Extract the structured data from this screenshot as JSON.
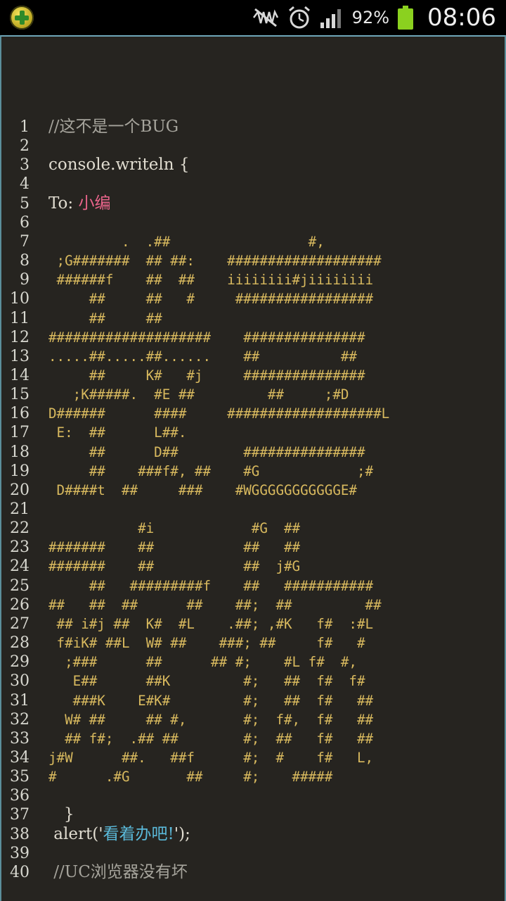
{
  "status_bar": {
    "battery_percent": "92%",
    "battery_level": 0.92,
    "time": "08:06",
    "icons": [
      "app-icon",
      "mute-icon",
      "alarm-icon",
      "signal-icon",
      "battery-icon"
    ],
    "colors": {
      "battery": "#8bd11f"
    }
  },
  "editor": {
    "background": "#262420",
    "lines": [
      {
        "n": "1",
        "text": "//这不是一个BUG"
      },
      {
        "n": "2",
        "text": ""
      },
      {
        "n": "3",
        "text": "console.writeln {"
      },
      {
        "n": "4",
        "text": ""
      },
      {
        "n": "5",
        "text": "To: ",
        "highlight": "小编"
      },
      {
        "n": "6",
        "text": ""
      },
      {
        "n": "7",
        "text": "         .  .##                 #,"
      },
      {
        "n": "8",
        "text": " ;G#######  ## ##:    ###################"
      },
      {
        "n": "9",
        "text": " ######f    ##  ##    iiiiiiii#jiiiiiiii"
      },
      {
        "n": "10",
        "text": "     ##     ##   #     #################"
      },
      {
        "n": "11",
        "text": "     ##     ##"
      },
      {
        "n": "12",
        "text": "####################    ###############"
      },
      {
        "n": "13",
        "text": ".....##.....##......    ##          ##"
      },
      {
        "n": "14",
        "text": "     ##     K#   #j     ###############"
      },
      {
        "n": "15",
        "text": "   ;K#####.  #E ##         ##     ;#D"
      },
      {
        "n": "16",
        "text": "D######      ####     ###################L"
      },
      {
        "n": "17",
        "text": " E:  ##      L##."
      },
      {
        "n": "18",
        "text": "     ##      D##        ###############"
      },
      {
        "n": "19",
        "text": "     ##    ###f#, ##    #G            ;#"
      },
      {
        "n": "20",
        "text": " D####t  ##     ###    #WGGGGGGGGGGGE#"
      },
      {
        "n": "21",
        "text": ""
      },
      {
        "n": "22",
        "text": "           #i            #G  ##"
      },
      {
        "n": "23",
        "text": "#######    ##           ##   ##"
      },
      {
        "n": "24",
        "text": "#######    ##           ##  j#G"
      },
      {
        "n": "25",
        "text": "     ##   #########f    ##   ###########"
      },
      {
        "n": "26",
        "text": "##   ##  ##      ##    ##;  ##         ##"
      },
      {
        "n": "27",
        "text": " ## i#j ##  K#  #L    .##; ,#K   f#  :#L"
      },
      {
        "n": "28",
        "text": " f#iK# ##L  W# ##    ###; ##     f#   #"
      },
      {
        "n": "29",
        "text": "  ;###      ##      ## #;    #L f#  #,"
      },
      {
        "n": "30",
        "text": "   E##      ##K         #;   ##  f#  f#"
      },
      {
        "n": "31",
        "text": "   ###K    E#K#         #;   ##  f#   ##"
      },
      {
        "n": "32",
        "text": "  W# ##     ## #,       #;  f#,  f#   ##"
      },
      {
        "n": "33",
        "text": "  ## f#;  .## ##        #;  ##   f#   ##"
      },
      {
        "n": "34",
        "text": "j#W      ##.   ##f      #;  #    f#   L,"
      },
      {
        "n": "35",
        "text": "#      .#G       ##     #;    #####"
      },
      {
        "n": "36",
        "text": ""
      },
      {
        "n": "37",
        "text": "   }"
      },
      {
        "n": "38",
        "text": " alert('",
        "highlight": "看着办吧!",
        "suffix": "');"
      },
      {
        "n": "39",
        "text": ""
      },
      {
        "n": "40",
        "text": " //UC浏览器没有坏"
      }
    ],
    "colors": {
      "ascii_art": "#d8b95e",
      "comment": "#a6a49c",
      "name_highlight": "#e8648a",
      "string_highlight": "#5ab8d8"
    }
  }
}
